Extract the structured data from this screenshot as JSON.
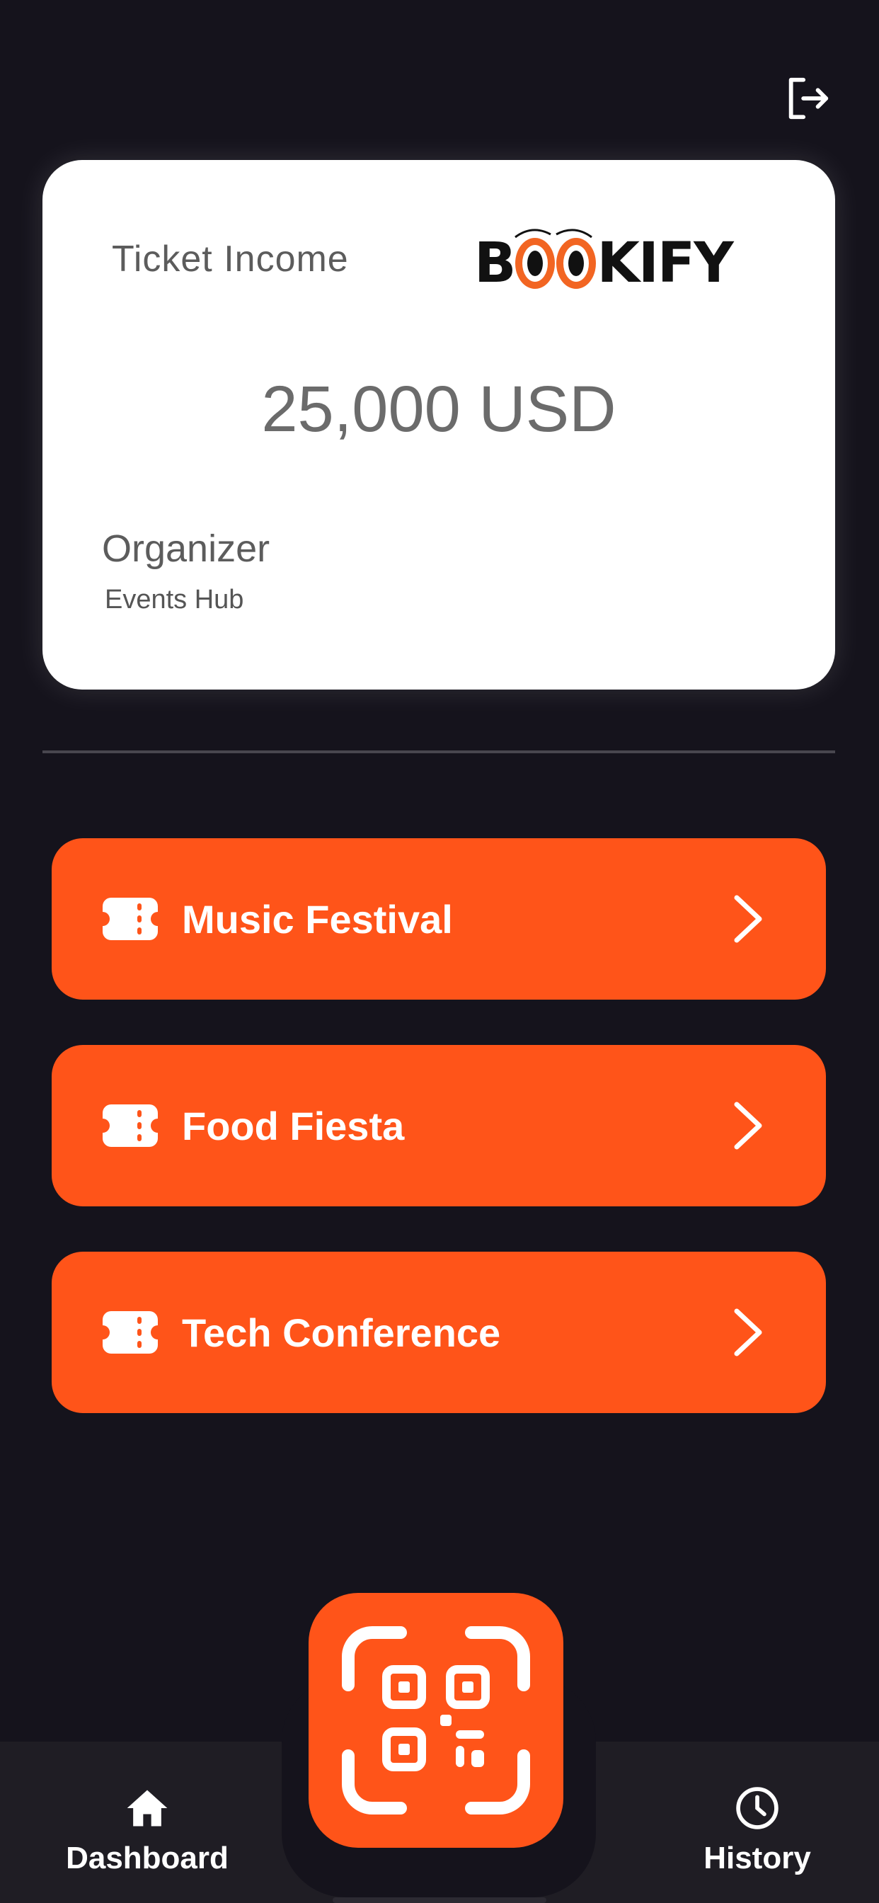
{
  "header": {
    "logout_icon": "logout-icon"
  },
  "card": {
    "title": "Ticket Income",
    "brand": {
      "letters_left": "B",
      "letters_right": "KIFY",
      "logo_colors": {
        "eye": "#f26522",
        "text": "#111111"
      }
    },
    "amount": "25,000 USD",
    "organizer_label": "Organizer",
    "organizer_name": "Events Hub"
  },
  "events": [
    {
      "label": "Music Festival",
      "icon": "ticket-icon"
    },
    {
      "label": "Food Fiesta",
      "icon": "ticket-icon"
    },
    {
      "label": "Tech Conference",
      "icon": "ticket-icon"
    }
  ],
  "nav": {
    "dashboard_label": "Dashboard",
    "history_label": "History",
    "scan_icon": "qr-scan-icon"
  },
  "colors": {
    "accent": "#ff5419",
    "background": "#15131c",
    "nav_background": "#1f1d24"
  }
}
